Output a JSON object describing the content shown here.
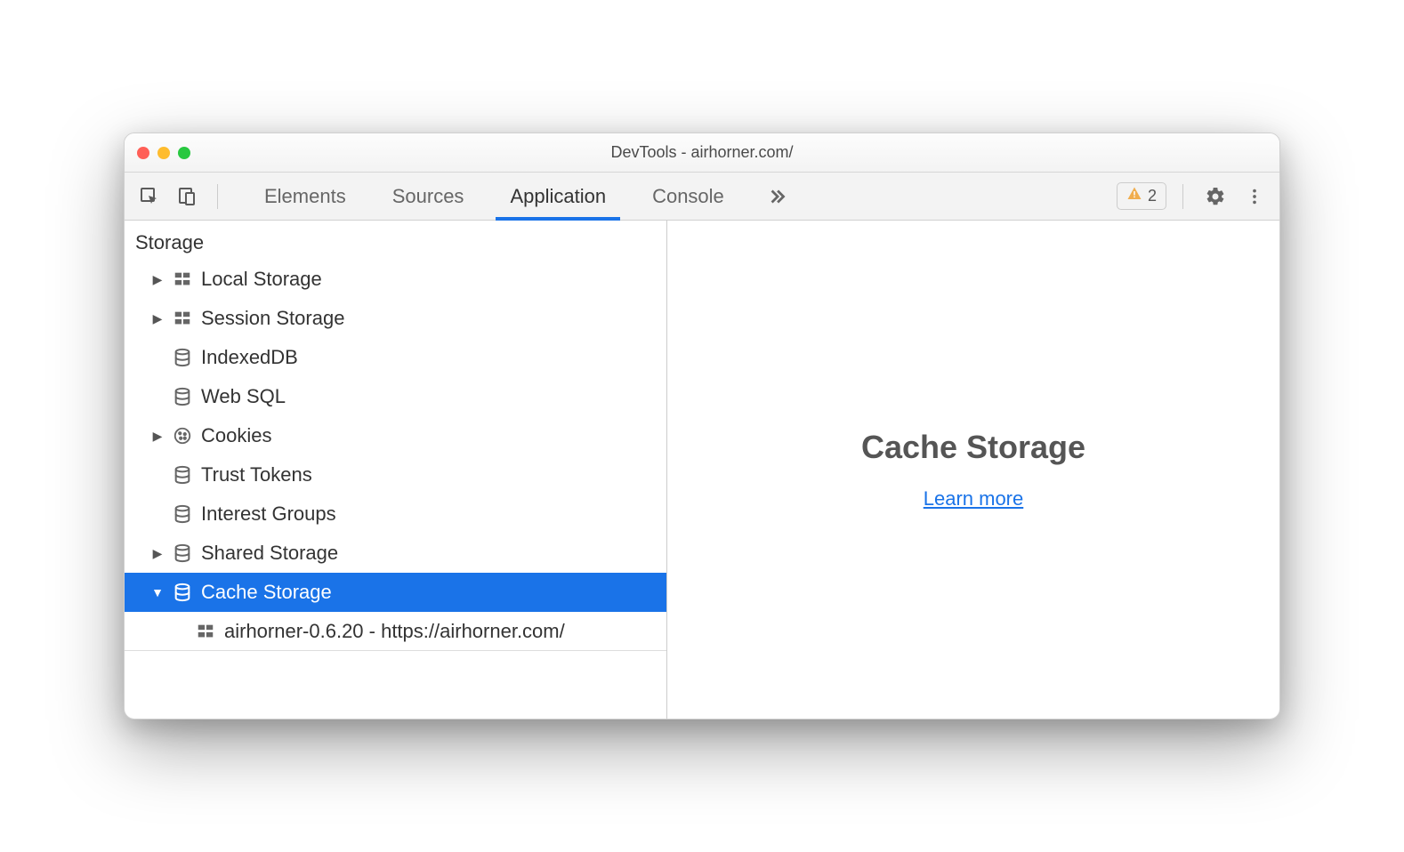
{
  "window": {
    "title": "DevTools - airhorner.com/"
  },
  "toolbar": {
    "tabs": [
      "Elements",
      "Sources",
      "Application",
      "Console"
    ],
    "active_tab_index": 2,
    "warning_count": "2"
  },
  "sidebar": {
    "category": "Storage",
    "items": [
      {
        "label": "Local Storage",
        "icon": "grid",
        "expandable": true,
        "expanded": false,
        "selected": false
      },
      {
        "label": "Session Storage",
        "icon": "grid",
        "expandable": true,
        "expanded": false,
        "selected": false
      },
      {
        "label": "IndexedDB",
        "icon": "db",
        "expandable": false,
        "expanded": false,
        "selected": false
      },
      {
        "label": "Web SQL",
        "icon": "db",
        "expandable": false,
        "expanded": false,
        "selected": false
      },
      {
        "label": "Cookies",
        "icon": "cookie",
        "expandable": true,
        "expanded": false,
        "selected": false
      },
      {
        "label": "Trust Tokens",
        "icon": "db",
        "expandable": false,
        "expanded": false,
        "selected": false
      },
      {
        "label": "Interest Groups",
        "icon": "db",
        "expandable": false,
        "expanded": false,
        "selected": false
      },
      {
        "label": "Shared Storage",
        "icon": "db",
        "expandable": true,
        "expanded": false,
        "selected": false
      },
      {
        "label": "Cache Storage",
        "icon": "db",
        "expandable": true,
        "expanded": true,
        "selected": true
      }
    ],
    "cache_child": {
      "label": "airhorner-0.6.20 - https://airhorner.com/"
    }
  },
  "main": {
    "heading": "Cache Storage",
    "link_label": "Learn more"
  }
}
